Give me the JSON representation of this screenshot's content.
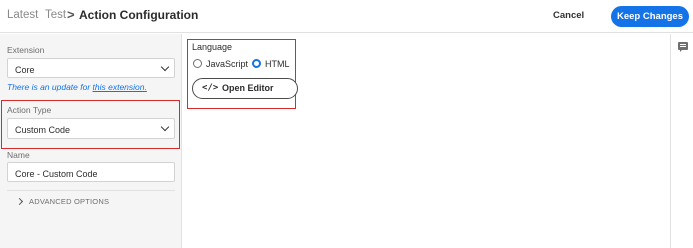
{
  "header": {
    "breadcrumb": [
      "Latest",
      "Test"
    ],
    "separator": ">",
    "title": "Action Configuration",
    "cancel_label": "Cancel",
    "keep_label": "Keep Changes",
    "accent_color": "#1473e6"
  },
  "sidebar": {
    "extension": {
      "label": "Extension",
      "value": "Core",
      "update_text": "There is an update for ",
      "update_link": "this extension."
    },
    "action_type": {
      "label": "Action Type",
      "value": "Custom Code"
    },
    "name": {
      "label": "Name",
      "value": "Core - Custom Code"
    },
    "advanced_label": "ADVANCED OPTIONS"
  },
  "main": {
    "language_label": "Language",
    "options": [
      {
        "label": "JavaScript",
        "selected": false
      },
      {
        "label": "HTML",
        "selected": true
      }
    ],
    "editor_icon": "</>",
    "editor_label": "Open Editor"
  },
  "highlight_color": "#d62b2b",
  "right_rail": {
    "icon": "comment-icon"
  }
}
